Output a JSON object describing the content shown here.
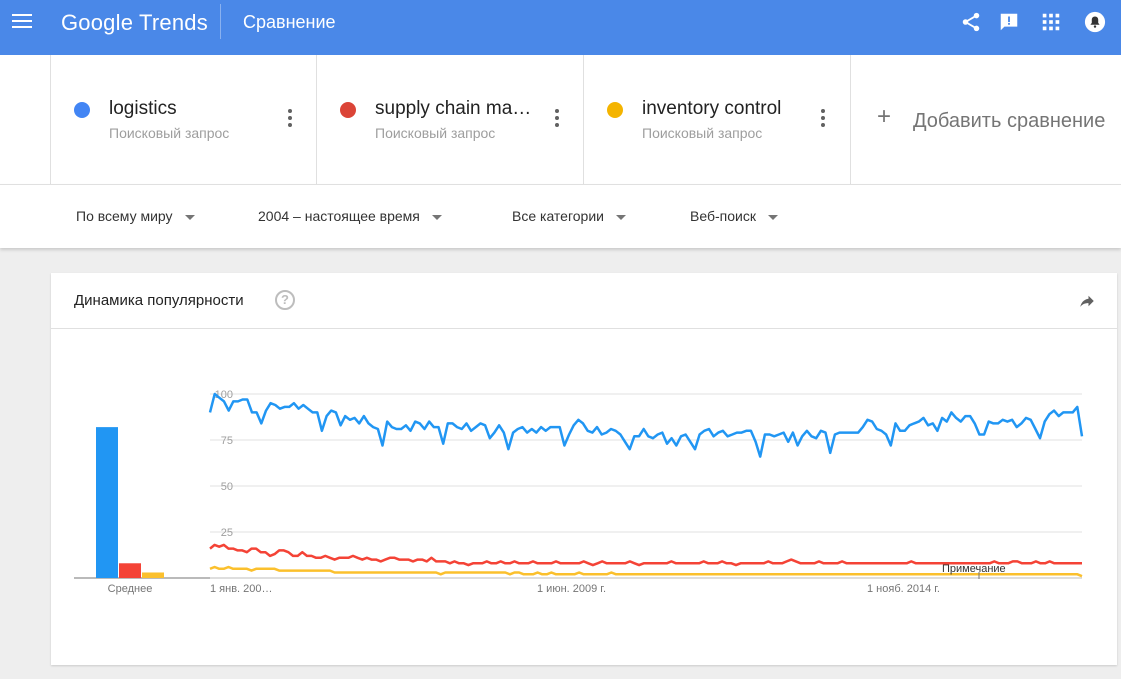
{
  "header": {
    "logo": "Google Trends",
    "title": "Сравнение"
  },
  "terms": [
    {
      "name": "logistics",
      "type": "Поисковый запрос",
      "color": "#4285f4"
    },
    {
      "name": "supply chain ma…",
      "type": "Поисковый запрос",
      "color": "#db4437"
    },
    {
      "name": "inventory control",
      "type": "Поисковый запрос",
      "color": "#f4b400"
    }
  ],
  "add_compare": {
    "plus": "+",
    "label": "Добавить сравнение"
  },
  "filters": {
    "region": "По всему миру",
    "period": "2004 – настоящее время",
    "category": "Все категории",
    "search_type": "Веб-поиск"
  },
  "card": {
    "title": "Динамика популярности",
    "help": "?"
  },
  "chart_data": [
    {
      "type": "bar",
      "categories": [
        "logistics",
        "supply chain management",
        "inventory control"
      ],
      "values": [
        82,
        8,
        3
      ],
      "colors": [
        "#2196f3",
        "#f44336",
        "#fbc02d"
      ],
      "xlabel": "Среднее"
    },
    {
      "type": "line",
      "yticks": [
        100,
        75,
        50,
        25
      ],
      "ylim": [
        0,
        100
      ],
      "xticks": [
        "1 янв. 200…",
        "1 июн. 2009 г.",
        "1 нояб. 2014 г."
      ],
      "annotation": "Примечание",
      "grid": true,
      "series": [
        {
          "name": "logistics",
          "color": "#2196f3",
          "values": [
            90,
            100,
            98,
            96,
            91,
            96,
            96,
            97,
            97,
            90,
            90,
            84,
            91,
            95,
            94,
            92,
            93,
            93,
            95,
            92,
            94,
            92,
            90,
            90,
            80,
            88,
            91,
            90,
            83,
            88,
            86,
            87,
            84,
            88,
            84,
            82,
            81,
            72,
            85,
            82,
            81,
            81,
            83,
            80,
            85,
            84,
            81,
            85,
            82,
            82,
            73,
            84,
            84,
            82,
            81,
            84,
            80,
            82,
            84,
            83,
            76,
            79,
            83,
            79,
            70,
            79,
            81,
            82,
            79,
            81,
            79,
            82,
            80,
            82,
            82,
            82,
            72,
            78,
            83,
            86,
            84,
            80,
            79,
            82,
            78,
            79,
            81,
            80,
            78,
            74,
            70,
            77,
            77,
            81,
            77,
            76,
            78,
            79,
            73,
            76,
            72,
            77,
            78,
            74,
            70,
            78,
            80,
            81,
            77,
            79,
            80,
            77,
            78,
            79,
            79,
            80,
            80,
            74,
            66,
            78,
            78,
            77,
            78,
            79,
            74,
            79,
            72,
            77,
            80,
            77,
            76,
            80,
            79,
            68,
            78,
            79,
            79,
            79,
            79,
            79,
            82,
            86,
            85,
            81,
            80,
            78,
            72,
            84,
            80,
            80,
            83,
            84,
            85,
            87,
            83,
            84,
            80,
            87,
            85,
            90,
            87,
            85,
            88,
            88,
            84,
            78,
            78,
            85,
            84,
            84,
            86,
            85,
            86,
            82,
            84,
            87,
            86,
            81,
            76,
            85,
            89,
            91,
            88,
            90,
            90,
            90,
            93,
            77
          ]
        },
        {
          "name": "supply chain management",
          "color": "#f44336",
          "values": [
            16,
            18,
            17,
            18,
            16,
            16,
            15,
            15,
            14,
            16,
            16,
            14,
            14,
            12,
            13,
            15,
            15,
            14,
            12,
            12,
            14,
            12,
            12,
            11,
            11,
            12,
            11,
            10,
            11,
            11,
            11,
            12,
            11,
            10,
            11,
            10,
            10,
            9,
            10,
            11,
            11,
            10,
            10,
            10,
            9,
            10,
            10,
            9,
            11,
            9,
            9,
            9,
            8,
            9,
            8,
            8,
            7,
            8,
            8,
            8,
            9,
            8,
            8,
            9,
            8,
            8,
            9,
            8,
            8,
            8,
            9,
            8,
            8,
            8,
            8,
            9,
            8,
            8,
            8,
            8,
            8,
            9,
            8,
            7,
            8,
            9,
            8,
            8,
            8,
            8,
            8,
            9,
            8,
            7,
            8,
            8,
            8,
            8,
            8,
            8,
            9,
            8,
            8,
            8,
            8,
            8,
            8,
            9,
            8,
            8,
            8,
            9,
            8,
            8,
            7,
            8,
            8,
            8,
            8,
            8,
            8,
            9,
            8,
            8,
            8,
            9,
            10,
            9,
            8,
            8,
            8,
            8,
            9,
            8,
            8,
            8,
            8,
            9,
            8,
            8,
            8,
            8,
            8,
            8,
            8,
            8,
            8,
            8,
            8,
            8,
            8,
            8,
            9,
            8,
            8,
            8,
            8,
            8,
            8,
            8,
            8,
            8,
            8,
            8,
            8,
            8,
            8,
            8,
            8,
            8,
            9,
            8,
            8,
            8,
            9,
            9,
            8,
            8,
            8,
            9,
            8,
            8,
            9,
            8,
            8,
            8,
            8,
            8,
            8,
            8
          ]
        },
        {
          "name": "inventory control",
          "color": "#fbc02d",
          "values": [
            5,
            6,
            5,
            5,
            6,
            5,
            5,
            5,
            5,
            4,
            5,
            5,
            5,
            5,
            5,
            4,
            4,
            4,
            4,
            4,
            4,
            4,
            4,
            4,
            4,
            4,
            4,
            3,
            3,
            3,
            3,
            3,
            3,
            3,
            3,
            3,
            3,
            3,
            3,
            3,
            3,
            3,
            3,
            3,
            3,
            3,
            3,
            3,
            3,
            3,
            2,
            3,
            3,
            3,
            3,
            3,
            3,
            3,
            3,
            3,
            3,
            3,
            3,
            3,
            3,
            2,
            3,
            3,
            2,
            2,
            2,
            3,
            2,
            2,
            3,
            2,
            2,
            2,
            2,
            2,
            3,
            2,
            2,
            2,
            2,
            2,
            2,
            3,
            2,
            2,
            2,
            2,
            2,
            2,
            2,
            2,
            2,
            2,
            2,
            2,
            2,
            2,
            2,
            2,
            2,
            2,
            2,
            2,
            2,
            2,
            2,
            2,
            2,
            2,
            2,
            2,
            2,
            2,
            2,
            2,
            2,
            2,
            2,
            2,
            2,
            2,
            2,
            2,
            2,
            2,
            2,
            2,
            2,
            2,
            2,
            2,
            2,
            2,
            2,
            2,
            2,
            2,
            2,
            2,
            2,
            2,
            2,
            2,
            2,
            2,
            2,
            2,
            2,
            2,
            2,
            2,
            2,
            2,
            2,
            2,
            2,
            2,
            2,
            2,
            2,
            2,
            2,
            2,
            2,
            2,
            2,
            2,
            2,
            2,
            2,
            2,
            2,
            2,
            2,
            2,
            2,
            2,
            2,
            2,
            2,
            2,
            2,
            2,
            2,
            1
          ]
        }
      ]
    }
  ]
}
